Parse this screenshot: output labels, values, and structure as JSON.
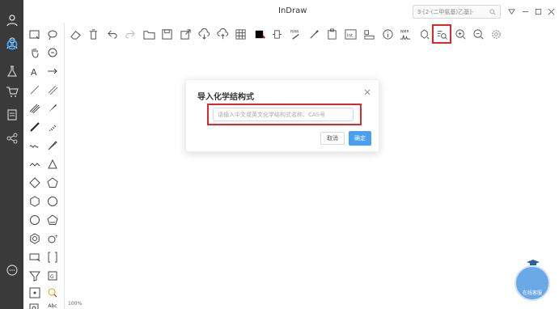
{
  "app": {
    "title": "InDraw"
  },
  "titlebar": {
    "search_text": "3-[2-(二甲氨基)乙基]-",
    "controls": [
      "collapse-icon",
      "minimize-icon",
      "maximize-icon",
      "close-icon"
    ]
  },
  "rail": {
    "items": [
      {
        "name": "user-icon"
      },
      {
        "name": "settings-gear-icon",
        "active": true
      },
      {
        "name": "flask-icon"
      },
      {
        "name": "cart-icon"
      },
      {
        "name": "notes-icon"
      },
      {
        "name": "share-icon"
      },
      {
        "name": "chat-icon"
      }
    ]
  },
  "toolbar": {
    "buttons": [
      {
        "name": "eraser-icon"
      },
      {
        "name": "trash-icon"
      },
      {
        "name": "undo-icon"
      },
      {
        "name": "redo-icon"
      },
      {
        "name": "open-folder-icon"
      },
      {
        "name": "save-icon"
      },
      {
        "name": "export-icon"
      },
      {
        "name": "cloud-download-icon"
      },
      {
        "name": "cloud-upload-icon"
      },
      {
        "name": "grid-icon"
      },
      {
        "name": "color-black-icon"
      },
      {
        "name": "atom-icon"
      },
      {
        "name": "raw-icon",
        "label": "RAW"
      },
      {
        "name": "clean-icon"
      },
      {
        "name": "clipboard-icon"
      },
      {
        "name": "int-icon",
        "label": "Int"
      },
      {
        "name": "structure-icon"
      },
      {
        "name": "info-icon"
      },
      {
        "name": "nmr-icon",
        "label": "NMR"
      },
      {
        "name": "3d-icon"
      },
      {
        "name": "name-to-structure-icon",
        "highlighted": true
      },
      {
        "name": "zoom-in-icon"
      },
      {
        "name": "zoom-out-icon"
      },
      {
        "name": "preferences-icon"
      }
    ]
  },
  "palette": {
    "abc_label": "Abc"
  },
  "canvas": {
    "zoom": "100%"
  },
  "dialog": {
    "title": "导入化学结构式",
    "placeholder": "请输入中文或英文化学结构式名称、CAS号",
    "cancel_label": "取消",
    "ok_label": "确定"
  },
  "mascot": {
    "label": "在线客服"
  },
  "colors": {
    "accent": "#4aa0f0",
    "highlight": "#e0262a",
    "rail": "#3a3a3a"
  }
}
